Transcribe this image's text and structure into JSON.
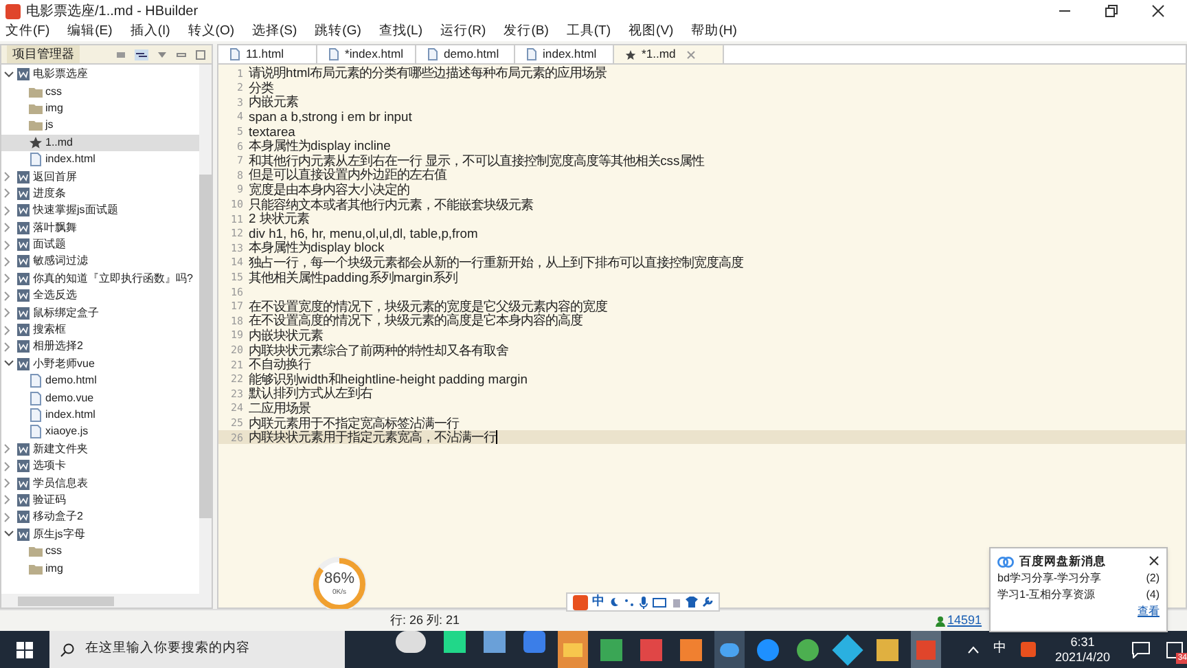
{
  "window": {
    "title": "电影票选座/1..md - HBuilder"
  },
  "menu": [
    "文件(F)",
    "编辑(E)",
    "插入(I)",
    "转义(O)",
    "选择(S)",
    "跳转(G)",
    "查找(L)",
    "运行(R)",
    "发行(B)",
    "工具(T)",
    "视图(V)",
    "帮助(H)"
  ],
  "sidebar": {
    "title": "项目管理器",
    "items": [
      {
        "label": "电影票选座",
        "kind": "project",
        "expanded": true,
        "selected": false,
        "children": [
          {
            "label": "css",
            "kind": "folder",
            "selected": false
          },
          {
            "label": "img",
            "kind": "folder",
            "selected": false
          },
          {
            "label": "js",
            "kind": "folder",
            "selected": false
          },
          {
            "label": "1..md",
            "kind": "star",
            "selected": true
          },
          {
            "label": "index.html",
            "kind": "file",
            "selected": false
          }
        ]
      },
      {
        "label": "返回首屏",
        "kind": "project",
        "expanded": false,
        "selected": false
      },
      {
        "label": "进度条",
        "kind": "project",
        "expanded": false,
        "selected": false
      },
      {
        "label": "快速掌握js面试题",
        "kind": "project",
        "expanded": false,
        "selected": false
      },
      {
        "label": "落叶飘舞",
        "kind": "project",
        "expanded": false,
        "selected": false
      },
      {
        "label": "面试题",
        "kind": "project",
        "expanded": false,
        "selected": false
      },
      {
        "label": "敏感词过滤",
        "kind": "project",
        "expanded": false,
        "selected": false
      },
      {
        "label": "你真的知道『立即执行函数』吗?",
        "kind": "project",
        "expanded": false,
        "selected": false
      },
      {
        "label": "全选反选",
        "kind": "project",
        "expanded": false,
        "selected": false
      },
      {
        "label": "鼠标绑定盒子",
        "kind": "project",
        "expanded": false,
        "selected": false
      },
      {
        "label": "搜索框",
        "kind": "project",
        "expanded": false,
        "selected": false
      },
      {
        "label": "相册选择2",
        "kind": "project",
        "expanded": false,
        "selected": false
      },
      {
        "label": "小野老师vue",
        "kind": "project",
        "expanded": true,
        "selected": false,
        "children": [
          {
            "label": "demo.html",
            "kind": "file",
            "selected": false
          },
          {
            "label": "demo.vue",
            "kind": "file",
            "selected": false
          },
          {
            "label": "index.html",
            "kind": "file",
            "selected": false
          },
          {
            "label": "xiaoye.js",
            "kind": "file",
            "selected": false
          }
        ]
      },
      {
        "label": "新建文件夹",
        "kind": "project",
        "expanded": false,
        "selected": false
      },
      {
        "label": "选项卡",
        "kind": "project",
        "expanded": false,
        "selected": false
      },
      {
        "label": "学员信息表",
        "kind": "project",
        "expanded": false,
        "selected": false
      },
      {
        "label": "验证码",
        "kind": "project",
        "expanded": false,
        "selected": false
      },
      {
        "label": "移动盒子2",
        "kind": "project",
        "expanded": false,
        "selected": false
      },
      {
        "label": "原生js字母",
        "kind": "project",
        "expanded": true,
        "selected": false,
        "children": [
          {
            "label": "css",
            "kind": "folder",
            "selected": false
          },
          {
            "label": "img",
            "kind": "folder",
            "selected": false
          }
        ]
      }
    ]
  },
  "tabs": [
    {
      "label": "11.html",
      "selected": false
    },
    {
      "label": "*index.html",
      "selected": false
    },
    {
      "label": "demo.html",
      "selected": false
    },
    {
      "label": "index.html",
      "selected": false
    },
    {
      "label": "*1..md",
      "selected": true
    }
  ],
  "editor": {
    "lines": [
      {
        "number": "1",
        "text": "请说明html布局元素的分类有哪些边描述每种布局元素的应用场景"
      },
      {
        "number": "2",
        "text": "分类"
      },
      {
        "number": "3",
        "text": "内嵌元素"
      },
      {
        "number": "4",
        "text": "span a b,strong  i em br input"
      },
      {
        "number": "5",
        "text": "textarea"
      },
      {
        "number": "6",
        "text": "本身属性为display incline"
      },
      {
        "number": "7",
        "text": "和其他行内元素从左到右在一行 显示，不可以直接控制宽度高度等其他相关css属性"
      },
      {
        "number": "8",
        "text": "但是可以直接设置内外边距的左右值"
      },
      {
        "number": "9",
        "text": "宽度是由本身内容大小决定的"
      },
      {
        "number": "10",
        "text": "只能容纳文本或者其他行内元素，不能嵌套块级元素"
      },
      {
        "number": "11",
        "text": "2 块状元素"
      },
      {
        "number": "12",
        "text": "div h1, h6, hr, menu,ol,ul,dl, table,p,from"
      },
      {
        "number": "13",
        "text": "本身属性为display block"
      },
      {
        "number": "14",
        "text": "独占一行，每一个块级元素都会从新的一行重新开始，从上到下排布可以直接控制宽度高度"
      },
      {
        "number": "15",
        "text": "其他相关属性padding系列margin系列"
      },
      {
        "number": "16"
      },
      {
        "number": "17",
        "text": "在不设置宽度的情况下，块级元素的宽度是它父级元素内容的宽度"
      },
      {
        "number": "18",
        "text": "在不设置高度的情况下，块级元素的高度是它本身内容的高度"
      },
      {
        "number": "19",
        "text": "内嵌块状元素"
      },
      {
        "number": "20",
        "text": "内联块状元素综合了前两种的特性却又各有取舍"
      },
      {
        "number": "21",
        "text": "不自动换行"
      },
      {
        "number": "22",
        "text": "能够识别width和heightline-height padding margin"
      },
      {
        "number": "23",
        "text": "默认排列方式从左到右"
      },
      {
        "number": "24",
        "text": "二应用场景"
      },
      {
        "number": "25",
        "text": "内联元素用于不指定宽高标签沾满一行"
      },
      {
        "number": "26",
        "text": "内联块状元素用于指定元素宽高，不沾满一行",
        "current": true
      }
    ]
  },
  "speed_widget": {
    "percent": "86%",
    "level": 0.86,
    "rate": "0K/s"
  },
  "ime_bar": {
    "mode": "中"
  },
  "status_bar": {
    "position": "行: 26 列: 21",
    "user": "14591"
  },
  "notification": {
    "title": "百度网盘新消息",
    "items": [
      {
        "text": "bd学习分享-学习分享",
        "count": "(2)"
      },
      {
        "text": "学习1-互相分享资源",
        "count": "(4)"
      }
    ],
    "link": "查看"
  },
  "taskbar": {
    "search_placeholder": "在这里输入你要搜索的内容",
    "ime": "中",
    "time": "6:31",
    "date": "2021/4/20",
    "badge": "34"
  }
}
